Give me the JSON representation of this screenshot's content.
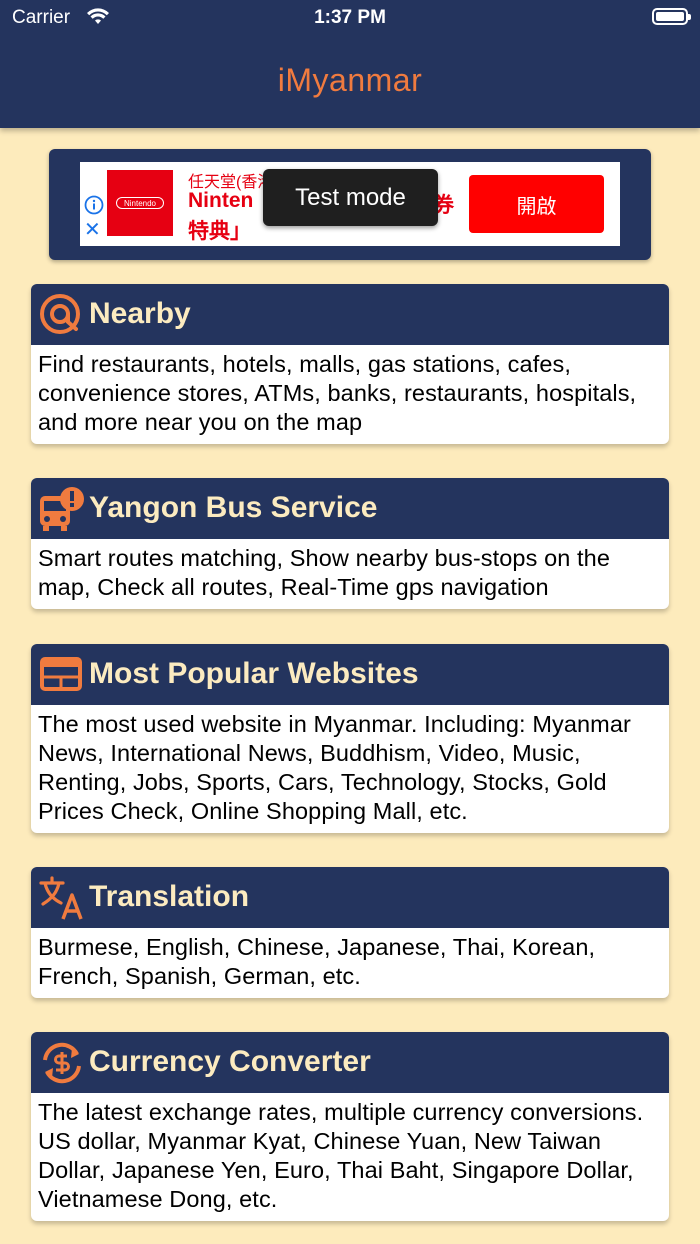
{
  "status_bar": {
    "carrier": "Carrier",
    "time": "1:37 PM"
  },
  "app": {
    "title": "iMyanmar",
    "title_color": "#F07B3F",
    "header_color": "#24345E",
    "background_color": "#FDEBBC"
  },
  "ad": {
    "brand_logo_text": "Nintendo",
    "line1": "任天堂(香港",
    "line2": "Ninten",
    "line2_tail": "券",
    "line3": "特典」",
    "open_label": "開啟",
    "toast": "Test mode"
  },
  "cards": [
    {
      "icon": "at-location-icon",
      "title": "Nearby",
      "description": "Find restaurants, hotels, malls, gas stations, cafes, convenience stores, ATMs, banks, restaurants, hospitals, and more near you on the map"
    },
    {
      "icon": "bus-alert-icon",
      "title": "Yangon Bus Service",
      "description": "Smart routes matching, Show nearby bus-stops on the map, Check all routes, Real-Time gps navigation"
    },
    {
      "icon": "browser-window-icon",
      "title": "Most Popular Websites",
      "description": "The most used website in Myanmar. Including: Myanmar News, International News, Buddhism, Video, Music, Renting, Jobs, Sports, Cars, Technology, Stocks, Gold Prices Check, Online Shopping Mall, etc."
    },
    {
      "icon": "translate-icon",
      "title": "Translation",
      "description": "Burmese, English, Chinese, Japanese, Thai, Korean, French, Spanish, German, etc."
    },
    {
      "icon": "currency-exchange-icon",
      "title": "Currency Converter",
      "description": "The latest exchange rates, multiple currency conversions. US dollar, Myanmar Kyat, Chinese Yuan, New Taiwan Dollar, Japanese Yen, Euro, Thai Baht, Singapore Dollar, Vietnamese Dong, etc."
    }
  ]
}
